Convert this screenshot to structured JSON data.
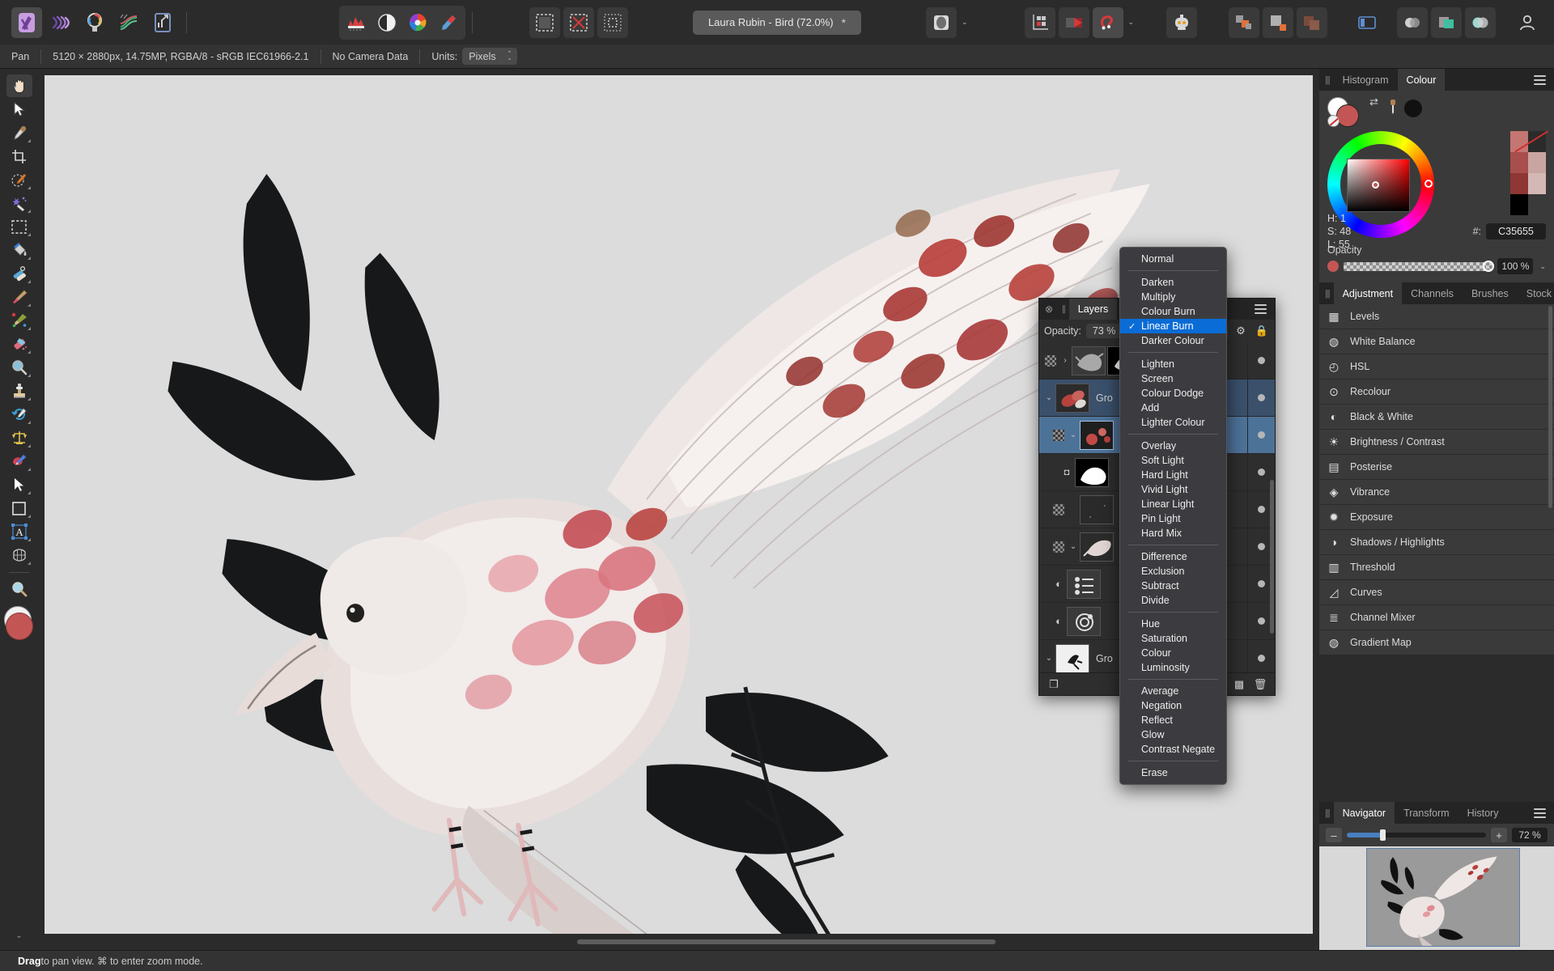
{
  "app": {
    "name": "Affinity Photo"
  },
  "toolbar": {
    "persona_icons": [
      "photo-persona-icon",
      "liquify-persona-icon",
      "develop-persona-icon",
      "tone-mapping-persona-icon",
      "export-persona-icon"
    ],
    "adjust_icons": [
      "levels-icon",
      "lighting-icon",
      "colour-wheel-icon",
      "liquify-icon"
    ],
    "mask_icons": [
      "select-pixels-icon",
      "deselect-icon",
      "invert-selection-icon"
    ],
    "doc_tab": {
      "title": "Laura Rubin - Bird (72.0%)",
      "modified_marker": "*"
    },
    "right_icons": [
      "preview-icon",
      "chevron-down-icon",
      "snapping-icon",
      "split-view-icon",
      "help-magnet-icon",
      "chevron-down-icon-2",
      "assistant-robot-icon"
    ],
    "far_right_icons": [
      "arrange-icon",
      "align-icon",
      "merge-icon",
      "panel-left-icon",
      "swatch-circle-icon",
      "swatch-square-icon",
      "swatch-overlap-icon",
      "account-icon"
    ]
  },
  "context_bar": {
    "tool_name": "Pan",
    "doc_info": "5120 × 2880px, 14.75MP, RGBA/8 - sRGB IEC61966-2.1",
    "camera": "No Camera Data",
    "units_label": "Units:",
    "units_value": "Pixels"
  },
  "tools": [
    {
      "name": "view-pan-tool",
      "glyph": "✋",
      "active": true,
      "has_corner": false
    },
    {
      "name": "move-tool",
      "glyph": "⬉",
      "active": false,
      "has_corner": false
    },
    {
      "name": "colour-picker-tool",
      "glyph": "🖊",
      "active": false,
      "has_corner": true
    },
    {
      "name": "crop-tool",
      "glyph": "⌗",
      "active": false,
      "has_corner": false
    },
    {
      "name": "selection-brush-tool",
      "glyph": "🖌",
      "active": false,
      "has_corner": true
    },
    {
      "name": "flood-select-tool",
      "glyph": "✨",
      "active": false,
      "has_corner": true
    },
    {
      "name": "marquee-tool",
      "glyph": "▢",
      "active": false,
      "has_corner": true
    },
    {
      "name": "flood-fill-tool",
      "glyph": "🪣",
      "active": false,
      "has_corner": true
    },
    {
      "name": "healing-brush-tool",
      "glyph": "💉",
      "active": false,
      "has_corner": true
    },
    {
      "name": "paint-brush-tool",
      "glyph": "🖌",
      "active": false,
      "has_corner": true
    },
    {
      "name": "paint-mixer-tool",
      "glyph": "🎨",
      "active": false,
      "has_corner": true
    },
    {
      "name": "erase-brush-tool",
      "glyph": "🧽",
      "active": false,
      "has_corner": true
    },
    {
      "name": "dodge-burn-tool",
      "glyph": "🔍",
      "active": false,
      "has_corner": true
    },
    {
      "name": "clone-brush-tool",
      "glyph": "🪧",
      "active": false,
      "has_corner": true
    },
    {
      "name": "undo-brush-tool",
      "glyph": "🖋",
      "active": false,
      "has_corner": true
    },
    {
      "name": "perspective-tool",
      "glyph": "⚖",
      "active": false,
      "has_corner": true
    },
    {
      "name": "smudge-brush-tool",
      "glyph": "🖌",
      "active": false,
      "has_corner": true
    },
    {
      "name": "node-tool",
      "glyph": "➤",
      "active": false,
      "has_corner": true
    },
    {
      "name": "rectangle-tool",
      "glyph": "▣",
      "active": false,
      "has_corner": true
    },
    {
      "name": "artistic-text-tool",
      "glyph": "Ⓐ",
      "active": false,
      "has_corner": true
    },
    {
      "name": "mesh-warp-tool",
      "glyph": "🗄",
      "active": false,
      "has_corner": true
    },
    {
      "name": "zoom-tool",
      "glyph": "🔎",
      "active": false,
      "has_corner": false
    }
  ],
  "colour_panel": {
    "tabs": [
      {
        "label": "Histogram",
        "selected": false
      },
      {
        "label": "Colour",
        "selected": true
      }
    ],
    "h_label": "H: 1",
    "s_label": "S: 48",
    "l_label": "L: 55",
    "hex_label": "#:",
    "hex_value": "C35655",
    "opacity_label": "Opacity",
    "opacity_value": "100 %",
    "foreground_colour": "#C35655",
    "background_colour": "#FFFFFF",
    "palette": [
      "#C47672",
      "#2B2B2B",
      "#A84E4C",
      "#C9A5A2",
      "#8E3734",
      "#D4B8B6",
      "#000000",
      "#FFFFFF"
    ]
  },
  "adjustment_panel": {
    "tabs": [
      {
        "label": "Adjustment",
        "selected": true
      },
      {
        "label": "Channels",
        "selected": false
      },
      {
        "label": "Brushes",
        "selected": false
      },
      {
        "label": "Stock",
        "selected": false
      }
    ],
    "items": [
      {
        "label": "Levels",
        "icon": "levels-icon",
        "glyph": "▦"
      },
      {
        "label": "White Balance",
        "icon": "white-balance-icon",
        "glyph": "◍"
      },
      {
        "label": "HSL",
        "icon": "hsl-icon",
        "glyph": "◴"
      },
      {
        "label": "Recolour",
        "icon": "recolour-icon",
        "glyph": "⊙"
      },
      {
        "label": "Black & White",
        "icon": "black-white-icon",
        "glyph": "◐"
      },
      {
        "label": "Brightness / Contrast",
        "icon": "brightness-contrast-icon",
        "glyph": "☀"
      },
      {
        "label": "Posterise",
        "icon": "posterise-icon",
        "glyph": "▤"
      },
      {
        "label": "Vibrance",
        "icon": "vibrance-icon",
        "glyph": "◈"
      },
      {
        "label": "Exposure",
        "icon": "exposure-icon",
        "glyph": "✹"
      },
      {
        "label": "Shadows / Highlights",
        "icon": "shadows-highlights-icon",
        "glyph": "◑"
      },
      {
        "label": "Threshold",
        "icon": "threshold-icon",
        "glyph": "▥"
      },
      {
        "label": "Curves",
        "icon": "curves-icon",
        "glyph": "◿"
      },
      {
        "label": "Channel Mixer",
        "icon": "channel-mixer-icon",
        "glyph": "≣"
      },
      {
        "label": "Gradient Map",
        "icon": "gradient-map-icon",
        "glyph": "◍"
      }
    ]
  },
  "navigator_panel": {
    "tabs": [
      {
        "label": "Navigator",
        "selected": true
      },
      {
        "label": "Transform",
        "selected": false
      },
      {
        "label": "History",
        "selected": false
      }
    ],
    "zoom_out_label": "–",
    "zoom_in_label": "+",
    "zoom_value": "72 %"
  },
  "layers_panel": {
    "title": "Layers",
    "opacity_label": "Opacity:",
    "opacity_value": "73 %",
    "blend_mode": "Linear Burn",
    "gear_icon": "settings-gear-icon",
    "lock_icon": "lock-icon",
    "rows": [
      {
        "name": "",
        "thumb": "bird-grey-thumb",
        "selected": false,
        "indent": 0,
        "twisty": "›",
        "visible": true,
        "locked": false
      },
      {
        "name": "Gro",
        "thumb": "flower-red-thumb",
        "selected": false,
        "indent": 0,
        "twisty": "⌄",
        "visible": true,
        "locked": false,
        "group": true
      },
      {
        "name": "",
        "thumb": "flowers-thumb",
        "selected": true,
        "indent": 1,
        "twisty": "⌄",
        "visible": true,
        "locked": false
      },
      {
        "name": "",
        "thumb": "bird-mask-thumb",
        "selected": false,
        "indent": 2,
        "twisty": "",
        "visible": true,
        "locked": true,
        "mask": true
      },
      {
        "name": "",
        "thumb": "dark-thumb",
        "selected": false,
        "indent": 1,
        "twisty": "",
        "visible": true,
        "locked": false
      },
      {
        "name": "",
        "thumb": "bird-pink-thumb",
        "selected": false,
        "indent": 1,
        "twisty": "⌄",
        "visible": true,
        "locked": false
      },
      {
        "name": "",
        "thumb": "levels-adj-thumb",
        "selected": false,
        "indent": 1,
        "twisty": "",
        "visible": true,
        "locked": false
      },
      {
        "name": "",
        "thumb": "hsl-adj-thumb",
        "selected": false,
        "indent": 1,
        "twisty": "",
        "visible": true,
        "locked": false
      },
      {
        "name": "Gro",
        "thumb": "leaf-white-thumb",
        "selected": false,
        "indent": 0,
        "twisty": "⌄",
        "visible": true,
        "locked": false,
        "group": true
      },
      {
        "name": "",
        "thumb": "leaf-dark-thumb",
        "selected": false,
        "indent": 1,
        "twisty": "",
        "visible": true,
        "locked": false
      },
      {
        "name": "",
        "thumb": "leaf-dark2-thumb",
        "selected": false,
        "indent": 1,
        "twisty": "",
        "visible": true,
        "locked": false
      }
    ],
    "footer_icons": [
      "new-layer-icon",
      "mask-icon",
      "adjustment-icon",
      "live-filter-icon",
      "fx-icon",
      "delete-icon"
    ]
  },
  "blend_menu": {
    "selected": "Linear Burn",
    "groups": [
      [
        "Normal"
      ],
      [
        "Darken",
        "Multiply",
        "Colour Burn",
        "Linear Burn",
        "Darker Colour"
      ],
      [
        "Lighten",
        "Screen",
        "Colour Dodge",
        "Add",
        "Lighter Colour"
      ],
      [
        "Overlay",
        "Soft Light",
        "Hard Light",
        "Vivid Light",
        "Linear Light",
        "Pin Light",
        "Hard Mix"
      ],
      [
        "Difference",
        "Exclusion",
        "Subtract",
        "Divide"
      ],
      [
        "Hue",
        "Saturation",
        "Colour",
        "Luminosity"
      ],
      [
        "Average",
        "Negation",
        "Reflect",
        "Glow",
        "Contrast Negate"
      ],
      [
        "Erase"
      ]
    ]
  },
  "status_bar": {
    "bold": "Drag",
    "text": " to pan view. ⌘ to enter zoom mode."
  }
}
